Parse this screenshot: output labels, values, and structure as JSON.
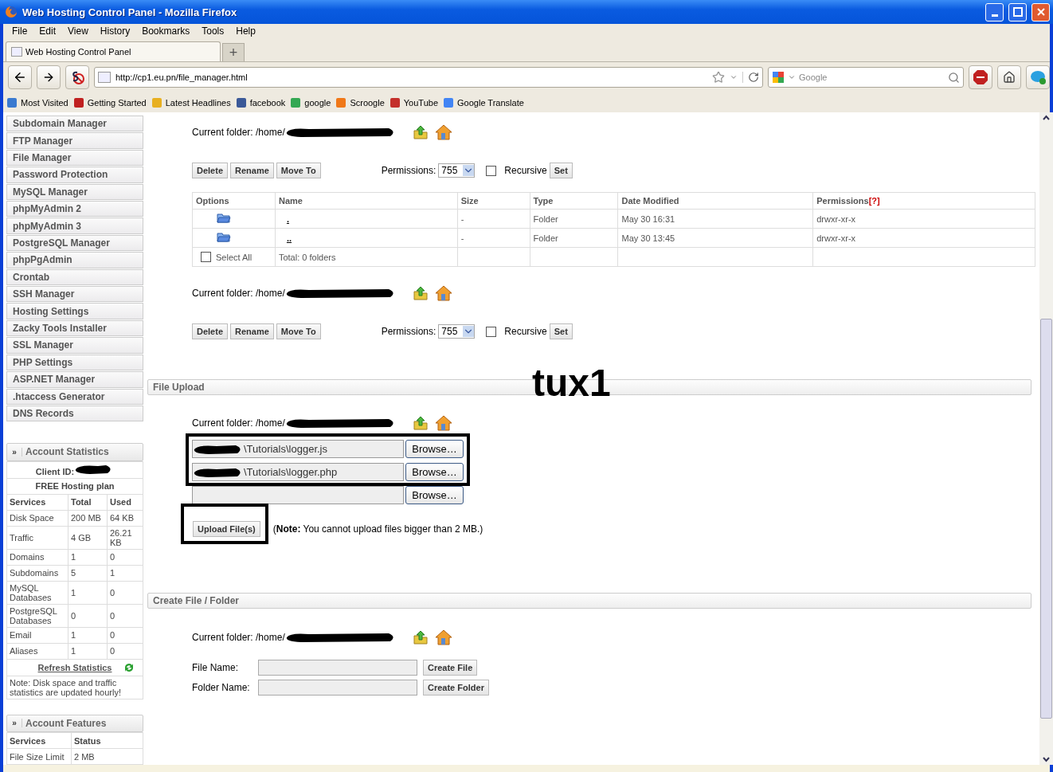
{
  "window": {
    "title": "Web Hosting Control Panel - Mozilla Firefox"
  },
  "menu": [
    "File",
    "Edit",
    "View",
    "History",
    "Bookmarks",
    "Tools",
    "Help"
  ],
  "tabs": [
    {
      "label": "Web Hosting Control Panel",
      "selected": true
    }
  ],
  "new_tab": "+",
  "address": "http://cp1.eu.pn/file_manager.html",
  "search": {
    "placeholder": "Google"
  },
  "bookmarks": [
    "Most Visited",
    "Getting Started",
    "Latest Headlines",
    "facebook",
    "google",
    "Scroogle",
    "YouTube",
    "Google Translate"
  ],
  "sidebar": {
    "items": [
      "Subdomain Manager",
      "FTP Manager",
      "File Manager",
      "Password Protection",
      "MySQL Manager",
      "phpMyAdmin 2",
      "phpMyAdmin 3",
      "PostgreSQL Manager",
      "phpPgAdmin",
      "Crontab",
      "SSH Manager",
      "Hosting Settings",
      "Zacky Tools Installer",
      "SSL Manager",
      "PHP Settings",
      "ASP.NET Manager",
      ".htaccess Generator",
      "DNS Records"
    ]
  },
  "account_statistics": {
    "toggle": "»",
    "title": "Account Statistics",
    "client_id": "Client ID:",
    "plan": "FREE Hosting plan",
    "columns": [
      "Services",
      "Total",
      "Used"
    ],
    "rows": [
      [
        "Disk Space",
        "200 MB",
        "64 KB"
      ],
      [
        "Traffic",
        "4 GB",
        "26.21 KB"
      ],
      [
        "Domains",
        "1",
        "0"
      ],
      [
        "Subdomains",
        "5",
        "1"
      ],
      [
        "MySQL Databases",
        "1",
        "0"
      ],
      [
        "PostgreSQL Databases",
        "0",
        "0"
      ],
      [
        "Email",
        "1",
        "0"
      ],
      [
        "Aliases",
        "1",
        "0"
      ]
    ],
    "refresh": "Refresh Statistics",
    "note": "Note: Disk space and traffic statistics are updated hourly!"
  },
  "account_features": {
    "toggle": "»",
    "title": "Account Features",
    "columns": [
      "Services",
      "Status"
    ],
    "rows": [
      [
        "File Size Limit",
        "2 MB"
      ]
    ]
  },
  "file_manager": {
    "folder_top": "Current folder: /home/",
    "folder_bottom": "Current folder: /home/",
    "toolbars": [
      {
        "actions": [
          "Delete",
          "Rename",
          "Move To"
        ],
        "permissions_label": "Permissions:",
        "permissions": "755",
        "recursive": {
          "label": "Recursive",
          "checked": false
        },
        "set": "Set"
      },
      {
        "actions": [
          "Delete",
          "Rename",
          "Move To"
        ],
        "permissions_label": "Permissions:",
        "permissions": "755",
        "recursive": {
          "label": "Recursive",
          "checked": false
        },
        "set": "Set"
      }
    ],
    "table": {
      "columns": [
        "Options",
        "Name",
        "Size",
        "Type",
        "Date Modified",
        "Permissions"
      ],
      "help": "[?]",
      "rows": [
        {
          "name": ".",
          "size": "-",
          "type": "Folder",
          "date": "May 30 16:31",
          "permissions": "drwxr-xr-x"
        },
        {
          "name": "..",
          "size": "-",
          "type": "Folder",
          "date": "May 30 13:45",
          "permissions": "drwxr-xr-x"
        }
      ],
      "select_all": {
        "label": "Select All",
        "checked": false
      },
      "total": "Total: 0 folders"
    }
  },
  "file_upload": {
    "title": "File Upload",
    "folder": "Current folder: /home/",
    "files": [
      {
        "value": "\\Tutorials\\logger.js",
        "browse": "Browse…"
      },
      {
        "value": "\\Tutorials\\logger.php",
        "browse": "Browse…"
      },
      {
        "browse": "Browse…"
      }
    ],
    "upload": "Upload File(s)",
    "note": "(**Note:** You cannot upload files bigger than 2 MB.)"
  },
  "create": {
    "title": "Create File / Folder",
    "folder": "Current folder: /home/",
    "fields": [
      {
        "label": "File Name:",
        "button": "Create File"
      },
      {
        "label": "Folder Name:",
        "button": "Create Folder"
      }
    ]
  },
  "annotation": "tux1"
}
